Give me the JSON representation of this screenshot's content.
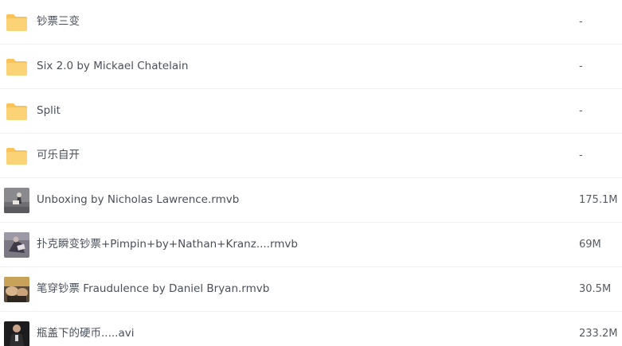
{
  "files": [
    {
      "name": "钞票三变",
      "size": "-",
      "type": "folder",
      "icon": "folder-icon"
    },
    {
      "name": "Six 2.0 by Mickael Chatelain",
      "size": "-",
      "type": "folder",
      "icon": "folder-icon"
    },
    {
      "name": "Split",
      "size": "-",
      "type": "folder",
      "icon": "folder-icon"
    },
    {
      "name": "可乐自开",
      "size": "-",
      "type": "folder",
      "icon": "folder-icon"
    },
    {
      "name": "Unboxing by Nicholas Lawrence.rmvb",
      "size": "175.1M",
      "type": "video",
      "icon": "video-thumbnail"
    },
    {
      "name": "扑克瞬变钞票+Pimpin+by+Nathan+Kranz....rmvb",
      "size": "69M",
      "type": "video",
      "icon": "video-thumbnail"
    },
    {
      "name": "笔穿钞票 Fraudulence by Daniel Bryan.rmvb",
      "size": "30.5M",
      "type": "video",
      "icon": "video-thumbnail"
    },
    {
      "name": "瓶盖下的硬币.....avi",
      "size": "233.2M",
      "type": "video",
      "icon": "video-thumbnail"
    }
  ],
  "colors": {
    "folder_body": "#fcd276",
    "folder_tab": "#f7c25a",
    "divider": "#eef0f3",
    "text": "#4a4f5a"
  }
}
